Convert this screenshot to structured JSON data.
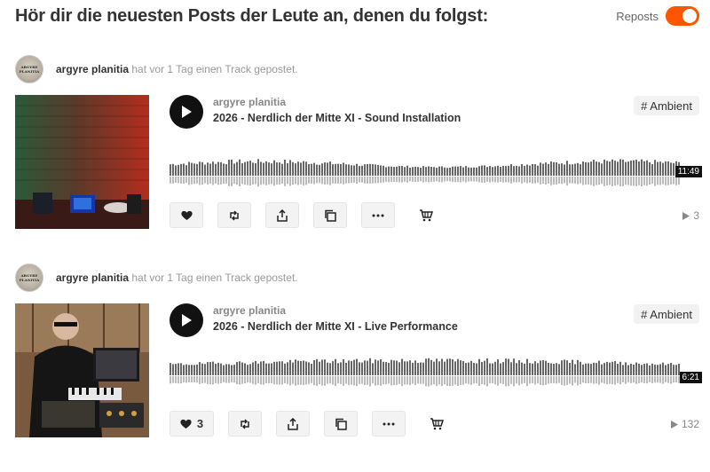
{
  "header": {
    "title": "Hör dir die neuesten Posts der Leute an, denen du folgst:",
    "repost_toggle_label": "Reposts",
    "repost_toggle_on": true,
    "accent": "#ff5500"
  },
  "posts": [
    {
      "user": "argyre planitia",
      "meta": "hat vor 1 Tag einen Track gepostet.",
      "avatar_text": [
        "ARGYRE",
        "PLANITIA"
      ],
      "artist": "argyre planitia",
      "track_title": "2026 - Nerdlich der Mitte XI - Sound Installation",
      "tag": "# Ambient",
      "duration": "11:49",
      "like_count": "",
      "play_count": "3",
      "icons": [
        "play-icon",
        "heart-icon",
        "repost-icon",
        "share-icon",
        "copy-icon",
        "more-icon",
        "cart-icon"
      ]
    },
    {
      "user": "argyre planitia",
      "meta": "hat vor 1 Tag einen Track gepostet.",
      "avatar_text": [
        "ARGYRE",
        "PLANITIA"
      ],
      "artist": "argyre planitia",
      "track_title": "2026 - Nerdlich der Mitte XI - Live Performance",
      "tag": "# Ambient",
      "duration": "6:21",
      "like_count": "3",
      "play_count": "132",
      "icons": [
        "play-icon",
        "heart-icon",
        "repost-icon",
        "share-icon",
        "copy-icon",
        "more-icon",
        "cart-icon"
      ]
    }
  ]
}
